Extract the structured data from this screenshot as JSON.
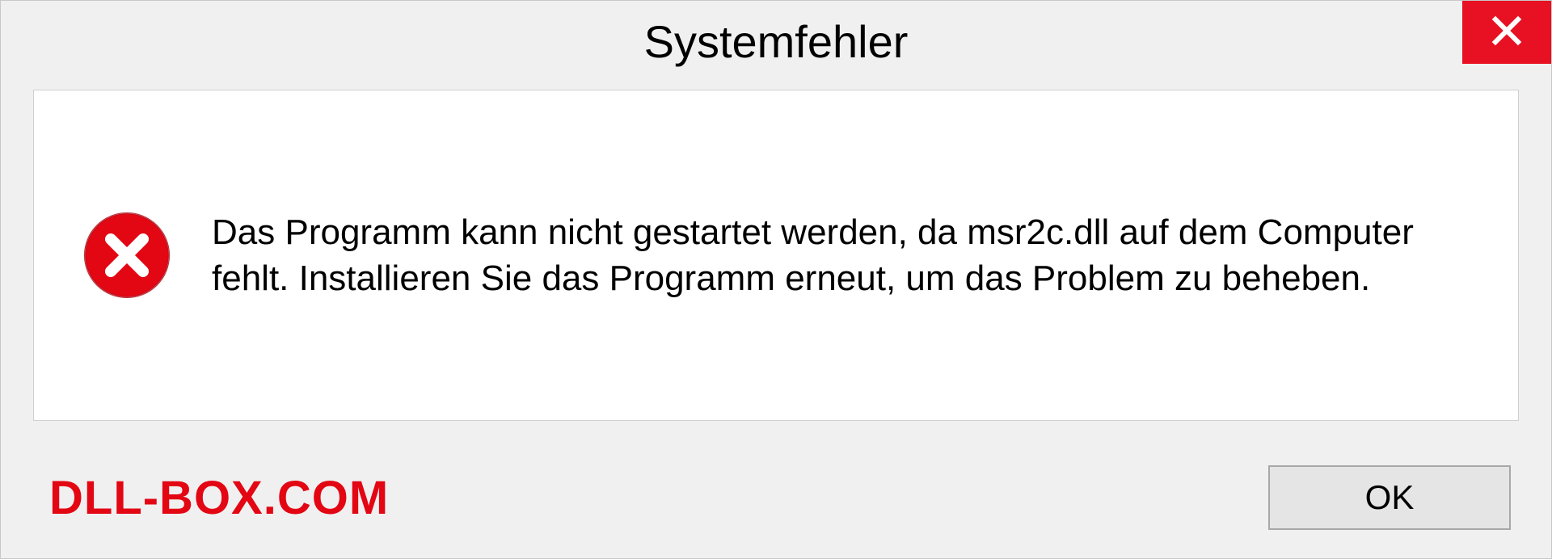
{
  "dialog": {
    "title": "Systemfehler",
    "message": "Das Programm kann nicht gestartet werden, da msr2c.dll auf dem Computer fehlt. Installieren Sie das Programm erneut, um das Problem zu beheben.",
    "ok_label": "OK"
  },
  "watermark": "DLL-BOX.COM",
  "colors": {
    "close_bg": "#e81123",
    "error_red": "#e30613",
    "watermark_red": "#e30613"
  }
}
